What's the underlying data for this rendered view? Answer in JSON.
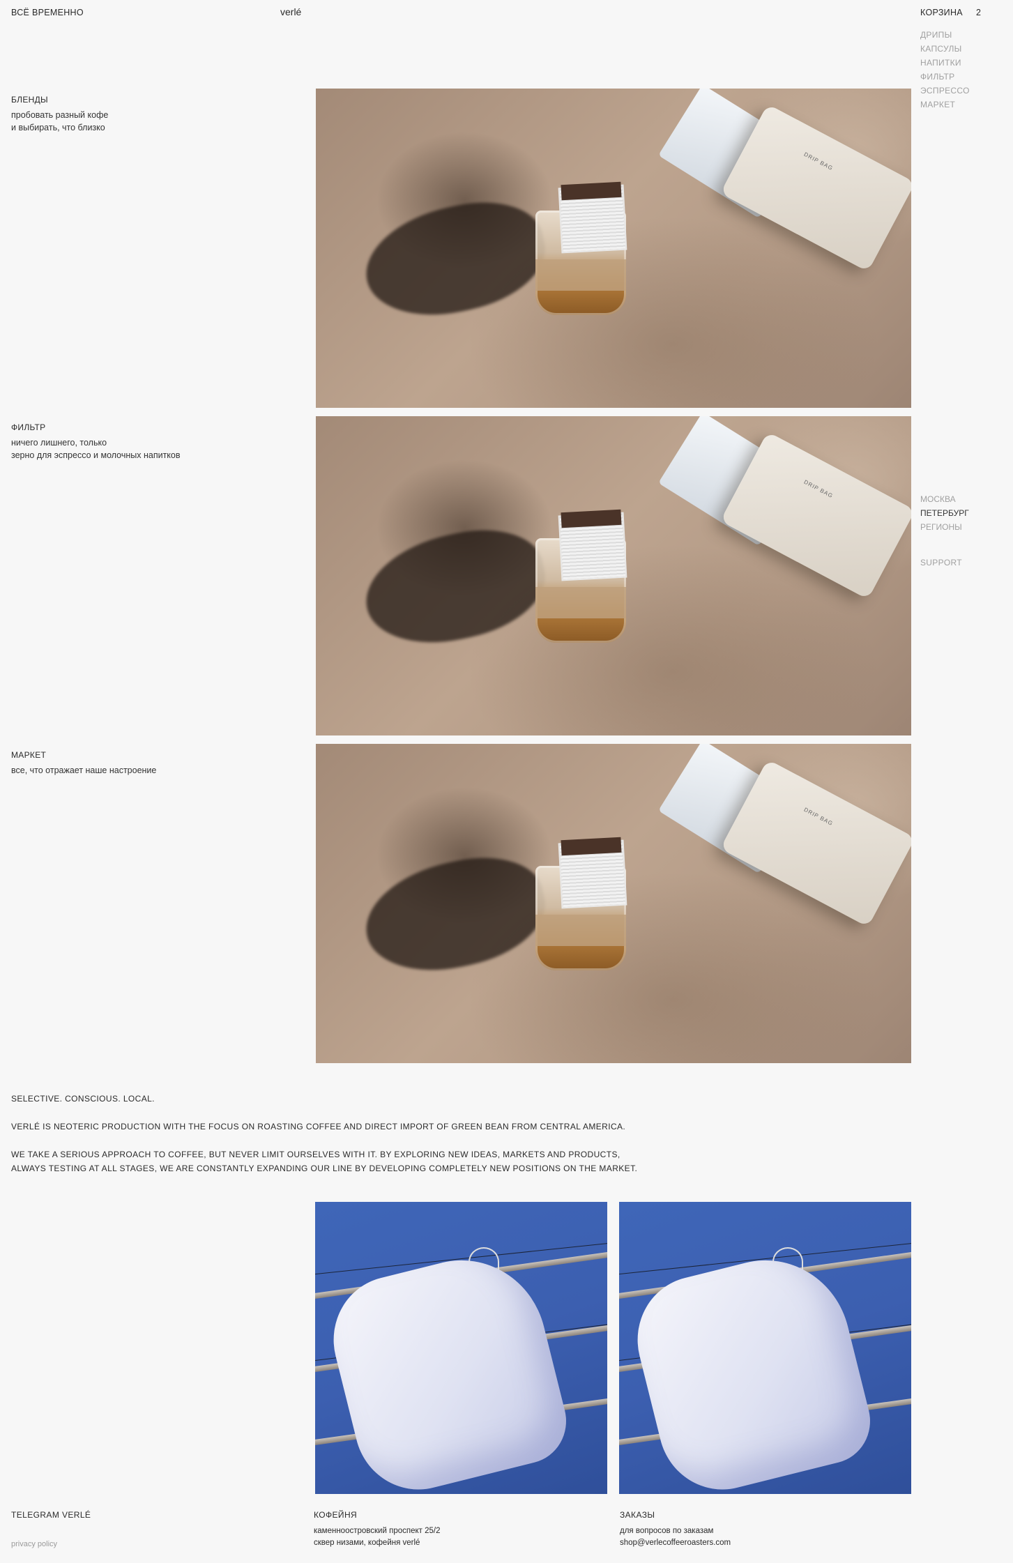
{
  "header": {
    "left_link": "ВСЁ ВРЕМЕННО",
    "brand": "verlé",
    "cart_label": "КОРЗИНА",
    "cart_count": "2"
  },
  "nav": {
    "items": [
      {
        "label": "ДРИПЫ"
      },
      {
        "label": "КАПСУЛЫ"
      },
      {
        "label": "НАПИТКИ"
      },
      {
        "label": "ФИЛЬТР"
      },
      {
        "label": "ЭСПРЕССО"
      },
      {
        "label": "МАРКЕТ"
      }
    ]
  },
  "cities": {
    "items": [
      {
        "label": "МОСКВА",
        "active": false
      },
      {
        "label": "ПЕТЕРБУРГ",
        "active": true
      },
      {
        "label": "РЕГИОНЫ",
        "active": false
      }
    ],
    "support": "SUPPORT"
  },
  "sections": [
    {
      "title": "БЛЕНДЫ",
      "desc_line1": "пробовать разный кофе",
      "desc_line2": "и выбирать, что близко",
      "image_label": "DRIP BAG"
    },
    {
      "title": "ФИЛЬТР",
      "desc_line1": "ничего лишнего, только",
      "desc_line2": "зерно для эспрессо и молочных напитков",
      "image_label": "DRIP BAG"
    },
    {
      "title": "МАРКЕТ",
      "desc_line1": "все, что отражает наше настроение",
      "desc_line2": "",
      "image_label": "DRIP BAG"
    }
  ],
  "about": {
    "tagline": "SELECTIVE. CONSCIOUS. LOCAL.",
    "p1": "VERLÉ IS NEOTERIC PRODUCTION WITH THE FOCUS ON ROASTING COFFEE AND DIRECT IMPORT OF GREEN BEAN FROM CENTRAL AMERICA.",
    "p2_line1": "WE TAKE A SERIOUS APPROACH TO COFFEE, BUT NEVER LIMIT OURSELVES WITH IT. BY EXPLORING NEW IDEAS, MARKETS AND PRODUCTS,",
    "p2_line2": "ALWAYS TESTING AT ALL STAGES, WE ARE CONSTANTLY EXPANDING OUR LINE BY DEVELOPING COMPLETELY NEW POSITIONS ON THE MARKET."
  },
  "footer": {
    "telegram": "TELEGRAM VERLÉ",
    "privacy": "privacy policy",
    "cafe_title": "КОФЕЙНЯ",
    "cafe_line1": "каменноостровский проспект 25/2",
    "cafe_line2": "сквер низами, кофейня verlé",
    "orders_title": "ЗАКАЗЫ",
    "orders_line1": "для вопросов по заказам",
    "orders_line2": "shop@verlecoffeeroasters.com"
  }
}
